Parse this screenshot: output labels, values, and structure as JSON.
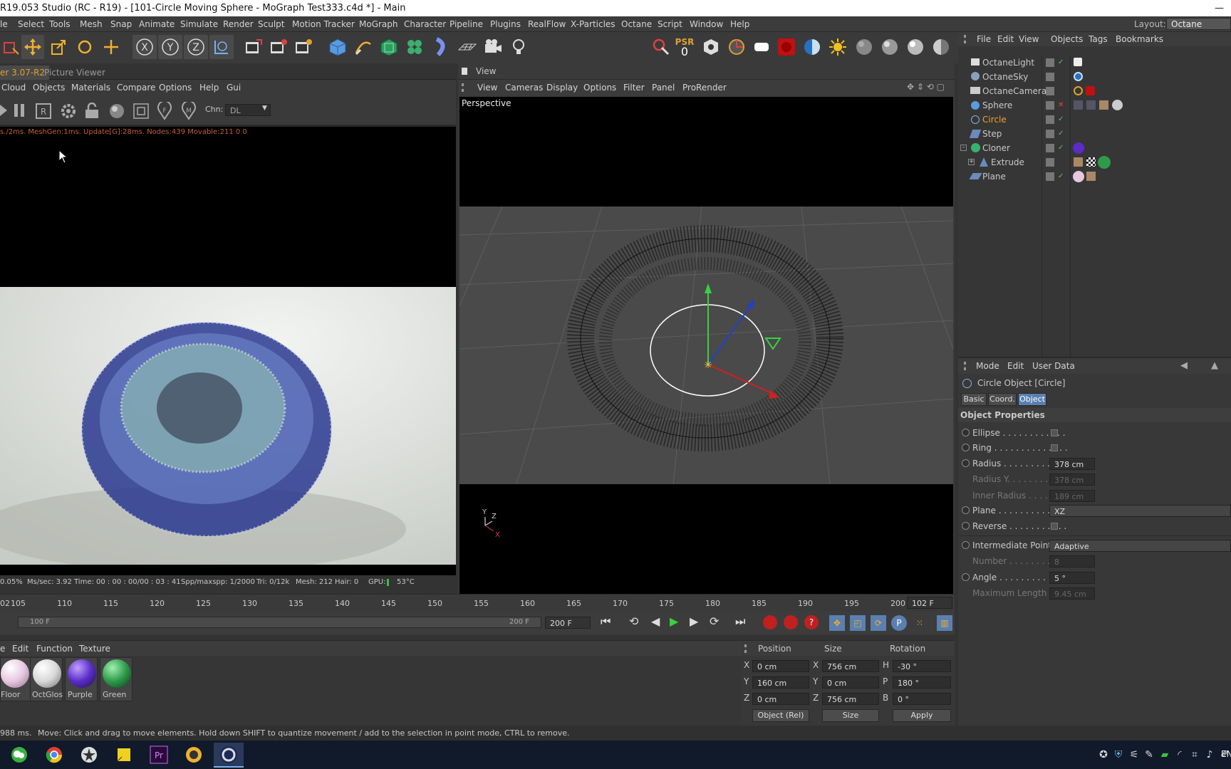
{
  "window": {
    "title": "R19.053 Studio (RC - R19) - [101-Circle Moving Sphere - MoGraph Test333.c4d *] - Main",
    "minimize": "—"
  },
  "menubar": {
    "items": [
      "le",
      "Select",
      "Tools",
      "Mesh",
      "Snap",
      "Animate",
      "Simulate",
      "Render",
      "Sculpt",
      "Motion Tracker",
      "MoGraph",
      "Character",
      "Pipeline",
      "Plugins",
      "RealFlow",
      "X-Particles",
      "Octane",
      "Script",
      "Window",
      "Help"
    ],
    "layout_label": "Layout:",
    "layout_value": "Octane (User)"
  },
  "toolbar": {
    "psr_label": "PSR",
    "psr_value": "0",
    "axis_x": "X",
    "axis_y": "Y",
    "axis_z": "Z"
  },
  "picture_viewer": {
    "tabs": [
      "er 3.07-R2",
      "Picture Viewer"
    ],
    "menu": [
      "Cloud",
      "Objects",
      "Materials",
      "Compare",
      "Options",
      "Help",
      "Gui"
    ],
    "chn_label": "Chn:",
    "chn_value": "DL",
    "stats": "s./2ms. MeshGen:1ms. Update[G]:28ms. Nodes:439 Movable:211  0 0",
    "bottom_stats": [
      "0.05%",
      "Ms/sec: 3.92",
      "Time: 00 : 00 : 00/00 : 03 : 41",
      "Spp/maxspp: 1/2000",
      "Tri: 0/12k",
      "Mesh: 212",
      "Hair: 0",
      "GPU:",
      "53°C"
    ]
  },
  "viewport": {
    "title": "View",
    "menu": [
      "View",
      "Cameras",
      "Display",
      "Options",
      "Filter",
      "Panel",
      "ProRender"
    ],
    "label": "Perspective",
    "axis_y": "Y",
    "axis_z": "Z",
    "axis_x": "X"
  },
  "object_manager": {
    "menu": [
      "File",
      "Edit",
      "View",
      "Objects",
      "Tags",
      "Bookmarks"
    ],
    "objects": [
      {
        "name": "OctaneLight",
        "color": "#c8c8c8"
      },
      {
        "name": "OctaneSky",
        "color": "#c8c8c8"
      },
      {
        "name": "OctaneCamera",
        "color": "#c8c8c8"
      },
      {
        "name": "Sphere",
        "color": "#c8c8c8"
      },
      {
        "name": "Circle",
        "color": "#f0a030"
      },
      {
        "name": "Step",
        "color": "#c8c8c8"
      },
      {
        "name": "Cloner",
        "color": "#c8c8c8"
      },
      {
        "name": "Extrude",
        "color": "#c8c8c8"
      },
      {
        "name": "Plane",
        "color": "#c8c8c8"
      }
    ]
  },
  "attributes": {
    "menu": [
      "Mode",
      "Edit",
      "User Data"
    ],
    "object_title": "Circle Object [Circle]",
    "tabs": [
      "Basic",
      "Coord.",
      "Object"
    ],
    "section": "Object Properties",
    "rows": [
      {
        "label": "Ellipse . . . . . . . . . . . .",
        "type": "check"
      },
      {
        "label": "Ring . . . . . . . . . . . . . .",
        "type": "check"
      },
      {
        "label": "Radius . . . . . . . . . . . . .",
        "value": "378 cm"
      },
      {
        "label": "Radius Y. . . . . . . . . . . .",
        "value": "378 cm"
      },
      {
        "label": "Inner Radius . . . . . . .",
        "value": "189 cm"
      },
      {
        "label": "Plane . . . . . . . . . . . . .",
        "value": "XZ"
      },
      {
        "label": "Reverse . . . . . . . . . . .",
        "type": "check"
      },
      {
        "label": "Intermediate Points",
        "value": "Adaptive"
      },
      {
        "label": "Number . . . . . . . . . . . .",
        "value": "8"
      },
      {
        "label": "Angle . . . . . . . . . . . . .",
        "value": "5 °"
      },
      {
        "label": "Maximum Length",
        "value": "9.45 cm"
      }
    ]
  },
  "timeline": {
    "ticks": [
      "02",
      "105",
      "110",
      "115",
      "120",
      "125",
      "130",
      "135",
      "140",
      "145",
      "150",
      "155",
      "160",
      "165",
      "170",
      "175",
      "180",
      "185",
      "190",
      "195",
      "200"
    ],
    "current_frame": "102 F",
    "range_start": "100 F",
    "range_end": "200 F",
    "end_field": "200 F"
  },
  "materials": {
    "menu": [
      "e",
      "Edit",
      "Function",
      "Texture"
    ],
    "items": [
      {
        "name": "Floor",
        "color": "#e6c8e0"
      },
      {
        "name": "OctGlos",
        "color": "#d8d8d8"
      },
      {
        "name": "Purple",
        "color": "#5a2cc8"
      },
      {
        "name": "Green",
        "color": "#2e9a4a"
      }
    ]
  },
  "coordinates": {
    "headers": [
      "Position",
      "Size",
      "Rotation"
    ],
    "rows": [
      {
        "axis": "X",
        "pos": "0 cm",
        "size_axis": "X",
        "size": "756 cm",
        "rot_axis": "H",
        "rot": "-30 °"
      },
      {
        "axis": "Y",
        "pos": "160 cm",
        "size_axis": "Y",
        "size": "0 cm",
        "rot_axis": "P",
        "rot": "180 °"
      },
      {
        "axis": "Z",
        "pos": "0 cm",
        "size_axis": "Z",
        "size": "756 cm",
        "rot_axis": "B",
        "rot": "0 °"
      }
    ],
    "mode": "Object (Rel)",
    "size_mode": "Size",
    "apply": "Apply"
  },
  "status": {
    "time": "988 ms.",
    "message": "Move: Click and drag to move elements. Hold down SHIFT to quantize movement / add to the selection in point mode, CTRL to remove."
  },
  "taskbar": {
    "lang": "EN"
  }
}
